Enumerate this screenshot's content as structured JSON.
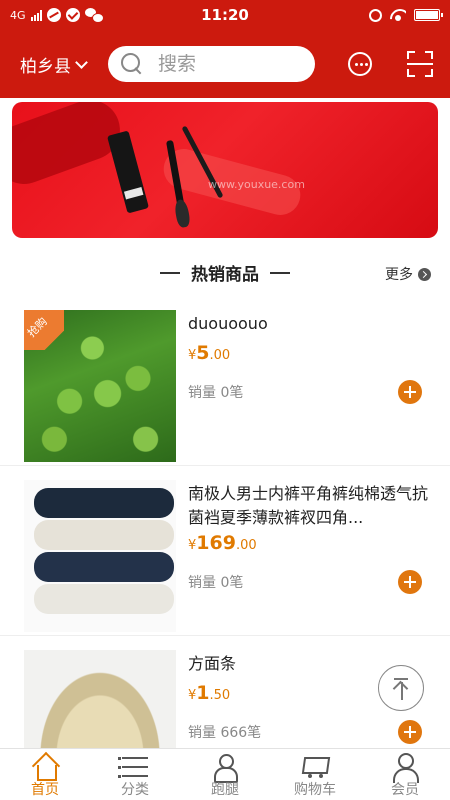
{
  "status_bar": {
    "network": "4G",
    "time": "11:20"
  },
  "header": {
    "location": "柏乡县",
    "search_placeholder": "搜索"
  },
  "banner": {
    "watermark": "www.youxue.com"
  },
  "section": {
    "title": "热销商品",
    "more": "更多"
  },
  "products": [
    {
      "name": "duouoouo",
      "currency": "¥",
      "price_int": "5",
      "price_dec": ".00",
      "sales": "销量 0笔",
      "tag": "抢购"
    },
    {
      "name": "南极人男士内裤平角裤纯棉透气抗菌裆夏季薄款裤衩四角...",
      "currency": "¥",
      "price_int": "169",
      "price_dec": ".00",
      "sales": "销量 0笔"
    },
    {
      "name": "方面条",
      "currency": "¥",
      "price_int": "1",
      "price_dec": ".50",
      "sales": "销量 666笔"
    }
  ],
  "tabbar": [
    {
      "label": "首页",
      "icon": "home-icon",
      "active": true
    },
    {
      "label": "分类",
      "icon": "list-icon"
    },
    {
      "label": "跑腿",
      "icon": "courier-icon"
    },
    {
      "label": "购物车",
      "icon": "cart-icon"
    },
    {
      "label": "会员",
      "icon": "user-icon"
    }
  ],
  "colors": {
    "brand_red": "#cc1a0e",
    "accent_orange": "#e07a00"
  }
}
